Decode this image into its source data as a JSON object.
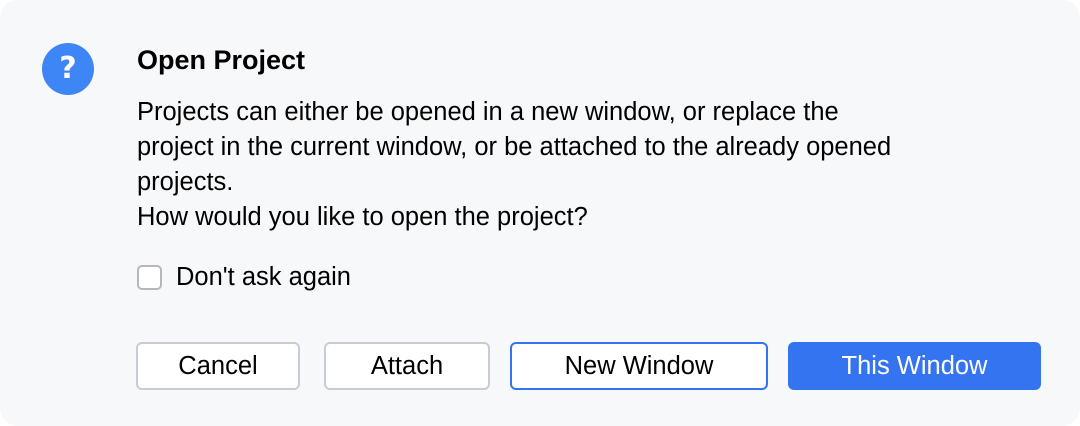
{
  "dialog": {
    "icon": "question-icon",
    "icon_glyph": "?",
    "accent_color": "#3574f0",
    "title": "Open Project",
    "message_lines": [
      "Projects can either be opened in a new window, or replace the",
      "project in the current window, or be attached to the already opened",
      "projects.",
      "How would you like to open the project?"
    ],
    "dont_ask_checked": false,
    "dont_ask_label": "Don't ask again",
    "buttons": {
      "cancel": "Cancel",
      "attach": "Attach",
      "new_window": "New Window",
      "this_window": "This Window"
    },
    "default_button": "This Window",
    "focused_button": "New Window"
  }
}
